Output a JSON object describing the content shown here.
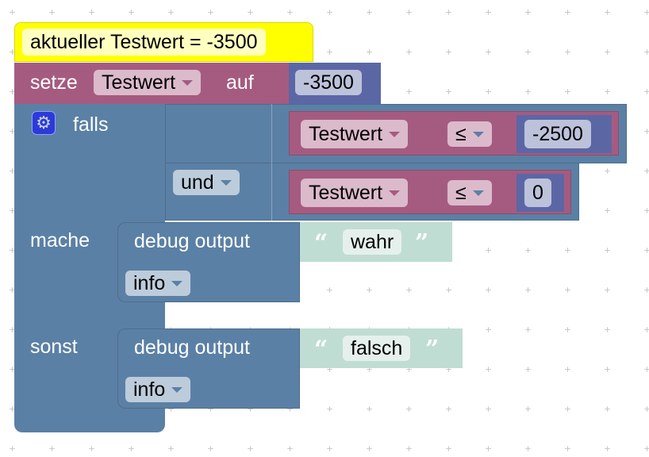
{
  "comment": {
    "text": "aktueller Testwert = -3500"
  },
  "set_block": {
    "label_set": "setze",
    "variable": "Testwert",
    "label_to": "auf",
    "value": "-3500"
  },
  "if_block": {
    "label_if": "falls",
    "settings_icon": "gear-icon",
    "logic_op": "und",
    "condition1": {
      "variable": "Testwert",
      "operator": "≤",
      "value": "-2500"
    },
    "condition2": {
      "variable": "Testwert",
      "operator": "≤",
      "value": "0"
    },
    "label_then": "mache",
    "label_else": "sonst",
    "then_stmt": {
      "label": "debug output",
      "level": "info",
      "text": "wahr"
    },
    "else_stmt": {
      "label": "debug output",
      "level": "info",
      "text": "falsch"
    }
  },
  "quotes": {
    "open": "“",
    "close": "”"
  },
  "colors": {
    "logic": "#5b80a5",
    "variable": "#a55b80",
    "math": "#5b67a5",
    "text": "#c0ddd3",
    "comment": "#ffff00"
  }
}
